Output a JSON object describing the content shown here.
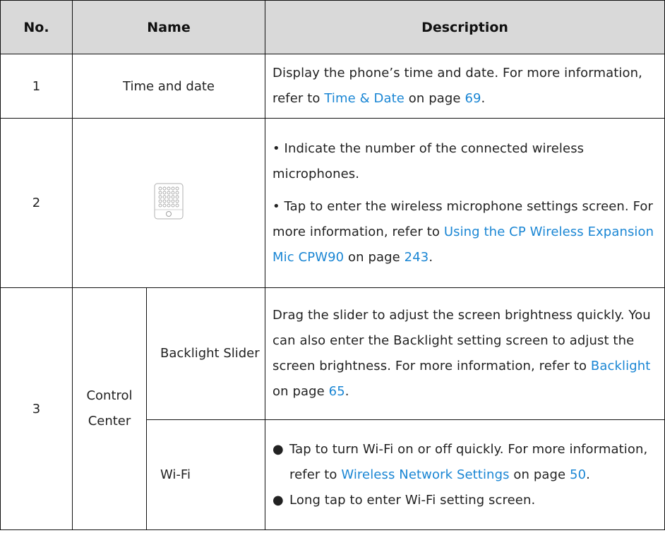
{
  "headers": {
    "no": "No.",
    "name": "Name",
    "description": "Description"
  },
  "rows": [
    {
      "no": "1",
      "name": "Time and date",
      "desc_pre": "Display the phone’s time and date. For more information, refer to ",
      "link": "Time & Date",
      "desc_mid": " on page ",
      "page": "69",
      "desc_end": "."
    },
    {
      "no": "2",
      "icon": "wireless-microphone-icon",
      "bullet1": "• Indicate the number of the connected wireless microphones.",
      "bullet2_pre": "• Tap to enter the wireless microphone settings screen. For more information, refer to ",
      "link": "Using the CP Wireless Expansion Mic CPW90",
      "desc_mid": " on page ",
      "page": "243",
      "desc_end": "."
    },
    {
      "no": "3",
      "name": "Control Center",
      "sub": [
        {
          "name": "Backlight Slider",
          "desc_pre": "Drag the slider to adjust the screen brightness quickly. You can also enter the Backlight setting screen to adjust the screen brightness. For more information, refer to ",
          "link": "Backlight",
          "desc_mid": " on page ",
          "page": "65",
          "desc_end": "."
        },
        {
          "name": "Wi-Fi",
          "bullet_symbol": "●",
          "item1_pre": "Tap to turn Wi-Fi on or off quickly. For more information, refer to ",
          "link": "Wireless Network Settings",
          "item1_mid": " on page ",
          "page": "50",
          "item1_end": ".",
          "item2": "Long tap to enter Wi-Fi setting screen."
        }
      ]
    }
  ],
  "colors": {
    "header_bg": "#d9d9d9",
    "link": "#1a86d4",
    "border": "#111111"
  }
}
